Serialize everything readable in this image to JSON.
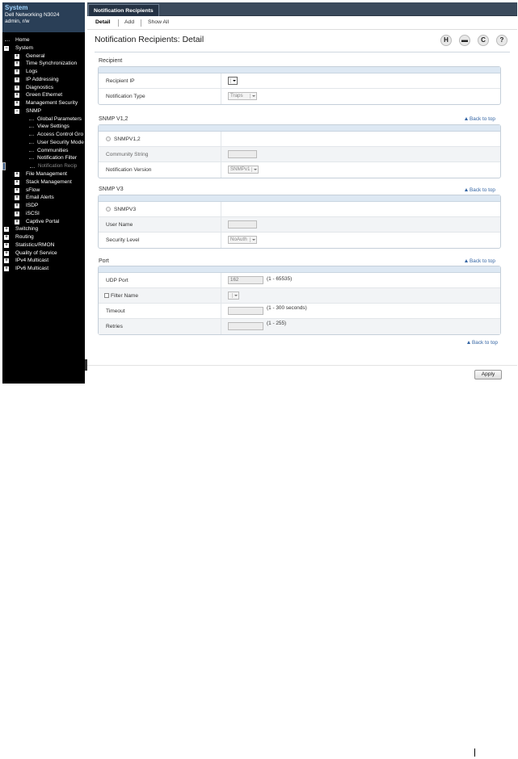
{
  "sidebar": {
    "title": "System",
    "device": "Dell Networking N3024",
    "user": "admin, r/w",
    "tree": [
      {
        "label": "Home",
        "level": 0,
        "toggle": ""
      },
      {
        "label": "System",
        "level": 0,
        "toggle": "−"
      },
      {
        "label": "General",
        "level": 1,
        "toggle": "+"
      },
      {
        "label": "Time Synchronization",
        "level": 1,
        "toggle": "+"
      },
      {
        "label": "Logs",
        "level": 1,
        "toggle": "+"
      },
      {
        "label": "IP Addressing",
        "level": 1,
        "toggle": "+"
      },
      {
        "label": "Diagnostics",
        "level": 1,
        "toggle": "+"
      },
      {
        "label": "Green Ethernet",
        "level": 1,
        "toggle": "+"
      },
      {
        "label": "Management Security",
        "level": 1,
        "toggle": "+"
      },
      {
        "label": "SNMP",
        "level": 1,
        "toggle": "−"
      },
      {
        "label": "Global Parameters",
        "level": 2,
        "toggle": ""
      },
      {
        "label": "View Settings",
        "level": 2,
        "toggle": ""
      },
      {
        "label": "Access Control Gro",
        "level": 2,
        "toggle": ""
      },
      {
        "label": "User Security Mode",
        "level": 2,
        "toggle": ""
      },
      {
        "label": "Communities",
        "level": 2,
        "toggle": ""
      },
      {
        "label": "Notification Filter",
        "level": 2,
        "toggle": ""
      },
      {
        "label": "Notification Recip",
        "level": 2,
        "toggle": "",
        "selected": true
      },
      {
        "label": "File Management",
        "level": 1,
        "toggle": "+"
      },
      {
        "label": "Stack Management",
        "level": 1,
        "toggle": "+"
      },
      {
        "label": "sFlow",
        "level": 1,
        "toggle": "+"
      },
      {
        "label": "Email Alerts",
        "level": 1,
        "toggle": "+"
      },
      {
        "label": "ISDP",
        "level": 1,
        "toggle": "+"
      },
      {
        "label": "iSCSI",
        "level": 1,
        "toggle": "+"
      },
      {
        "label": "Captive Portal",
        "level": 1,
        "toggle": "+"
      },
      {
        "label": "Switching",
        "level": 0,
        "toggle": "+"
      },
      {
        "label": "Routing",
        "level": 0,
        "toggle": "+"
      },
      {
        "label": "Statistics/RMON",
        "level": 0,
        "toggle": "+"
      },
      {
        "label": "Quality of Service",
        "level": 0,
        "toggle": "+"
      },
      {
        "label": "IPv4 Multicast",
        "level": 0,
        "toggle": "+"
      },
      {
        "label": "IPv6 Multicast",
        "level": 0,
        "toggle": "+"
      }
    ]
  },
  "top_tab": "Notification Recipients",
  "subnav": {
    "detail": "Detail",
    "add": "Add",
    "show_all": "Show All"
  },
  "page_title": "Notification Recipients: Detail",
  "toolbar_icons": [
    "save-icon",
    "print-icon",
    "refresh-icon",
    "help-icon"
  ],
  "back_to_top": "Back to top",
  "sections": {
    "recipient": {
      "title": "Recipient",
      "recipient_ip_label": "Recipient IP",
      "notification_type_label": "Notification Type",
      "notification_type_value": "Traps"
    },
    "snmpv12": {
      "title": "SNMP V1,2",
      "radio_label": "SNMPV1,2",
      "community_label": "Community String",
      "version_label": "Notification Version",
      "version_value": "SNMPv1"
    },
    "snmpv3": {
      "title": "SNMP V3",
      "radio_label": "SNMPV3",
      "user_label": "User Name",
      "security_label": "Security Level",
      "security_value": "NoAuth"
    },
    "port": {
      "title": "Port",
      "udp_label": "UDP Port",
      "udp_value": "162",
      "udp_hint": "(1 - 65535)",
      "filter_label": "Filter Name",
      "timeout_label": "Timeout",
      "timeout_hint": "(1 - 300 seconds)",
      "retries_label": "Retries",
      "retries_hint": "(1 - 255)"
    }
  },
  "apply_label": "Apply"
}
